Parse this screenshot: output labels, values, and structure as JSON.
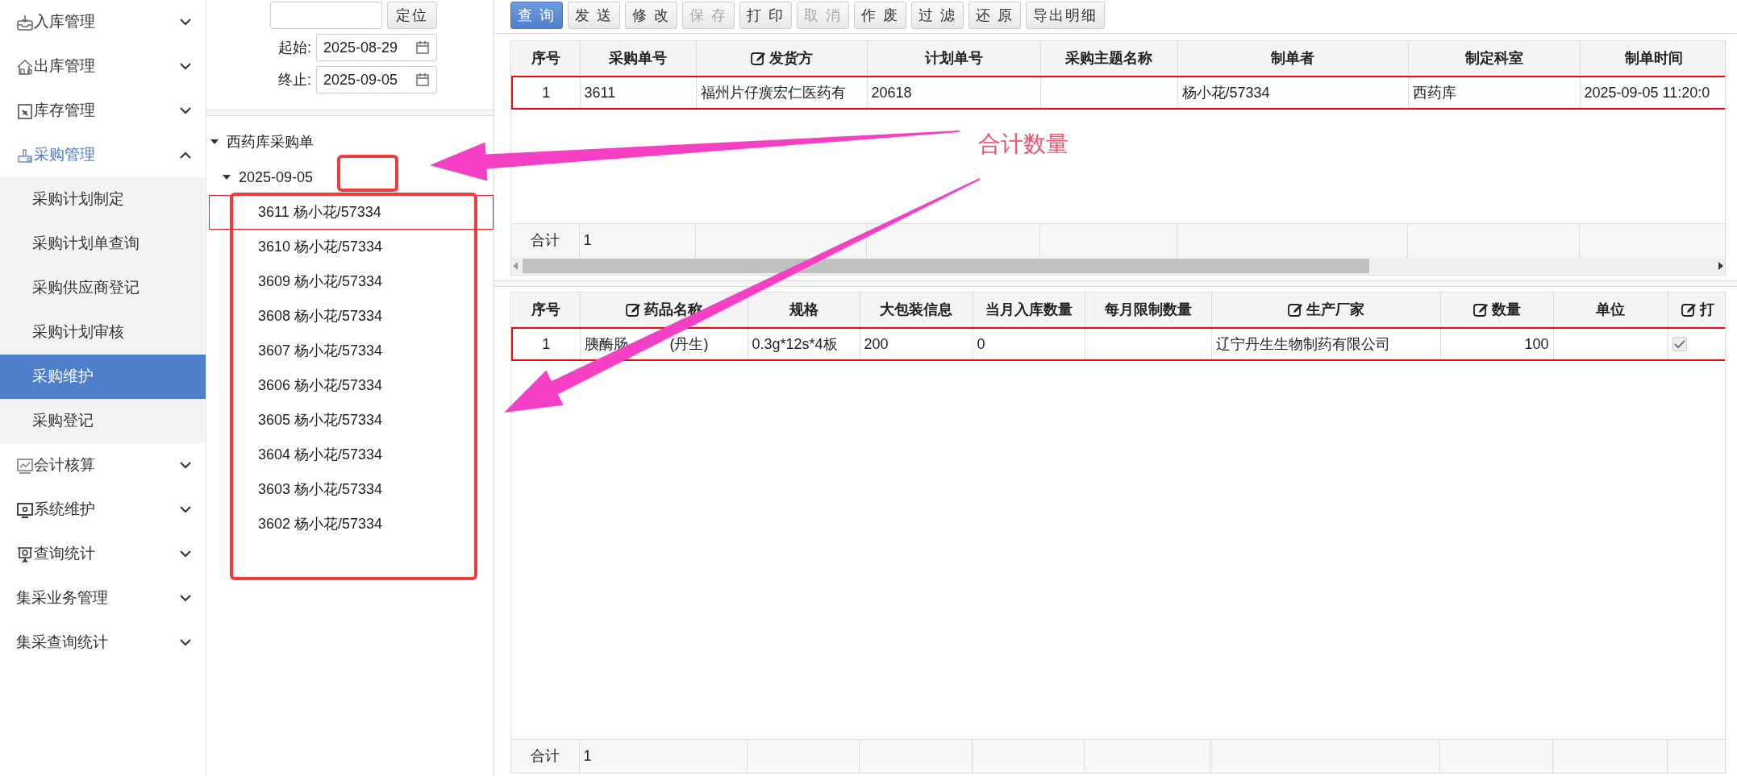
{
  "sidebar": {
    "items": [
      {
        "label": "入库管理",
        "expanded": false
      },
      {
        "label": "出库管理",
        "expanded": false
      },
      {
        "label": "库存管理",
        "expanded": false
      },
      {
        "label": "采购管理",
        "expanded": true,
        "children": [
          {
            "label": "采购计划制定",
            "selected": false
          },
          {
            "label": "采购计划单查询",
            "selected": false
          },
          {
            "label": "采购供应商登记",
            "selected": false
          },
          {
            "label": "采购计划审核",
            "selected": false
          },
          {
            "label": "采购维护",
            "selected": true
          },
          {
            "label": "采购登记",
            "selected": false
          }
        ]
      },
      {
        "label": "会计核算",
        "expanded": false
      },
      {
        "label": "系统维护",
        "expanded": false
      },
      {
        "label": "查询统计",
        "expanded": false
      },
      {
        "label": "集采业务管理",
        "expanded": false
      },
      {
        "label": "集采查询统计",
        "expanded": false
      }
    ]
  },
  "filter": {
    "locate_button": "定位",
    "start": {
      "label": "起始:",
      "value": "2025-08-29"
    },
    "end": {
      "label": "终止:",
      "value": "2025-09-05"
    }
  },
  "tree": {
    "label": "西药库采购单",
    "expanded": true,
    "children": [
      {
        "label": "2025-09-05",
        "expanded": true,
        "children": [
          {
            "label": "3611 杨小花/57334",
            "selected": true
          },
          {
            "label": "3610 杨小花/57334",
            "selected": false
          },
          {
            "label": "3609 杨小花/57334",
            "selected": false
          },
          {
            "label": "3608 杨小花/57334",
            "selected": false
          },
          {
            "label": "3607 杨小花/57334",
            "selected": false
          },
          {
            "label": "3606 杨小花/57334",
            "selected": false
          },
          {
            "label": "3605 杨小花/57334",
            "selected": false
          },
          {
            "label": "3604 杨小花/57334",
            "selected": false
          },
          {
            "label": "3603 杨小花/57334",
            "selected": false
          },
          {
            "label": "3602 杨小花/57334",
            "selected": false
          }
        ]
      }
    ]
  },
  "toolbar": [
    {
      "label": "查 询",
      "primary": true,
      "disabled": false
    },
    {
      "label": "发 送",
      "primary": false,
      "disabled": false
    },
    {
      "label": "修 改",
      "primary": false,
      "disabled": false
    },
    {
      "label": "保 存",
      "primary": false,
      "disabled": true
    },
    {
      "label": "打 印",
      "primary": false,
      "disabled": false
    },
    {
      "label": "取 消",
      "primary": false,
      "disabled": true
    },
    {
      "label": "作 废",
      "primary": false,
      "disabled": false
    },
    {
      "label": "过 滤",
      "primary": false,
      "disabled": false
    },
    {
      "label": "还 原",
      "primary": false,
      "disabled": false
    },
    {
      "label": "导出明细",
      "primary": false,
      "disabled": false
    }
  ],
  "order_table": {
    "columns": [
      {
        "label": "序号",
        "editable": false
      },
      {
        "label": "采购单号",
        "editable": false
      },
      {
        "label": "发货方",
        "editable": true
      },
      {
        "label": "计划单号",
        "editable": false
      },
      {
        "label": "采购主题名称",
        "editable": false
      },
      {
        "label": "制单者",
        "editable": false
      },
      {
        "label": "制定科室",
        "editable": false
      },
      {
        "label": "制单时间",
        "editable": false
      }
    ],
    "rows": [
      {
        "selected": true,
        "cells": [
          "1",
          "3611",
          "福州片仔癀宏仁医药有",
          "20618",
          "",
          "杨小花/57334",
          "西药库",
          "2025-09-05 11:20:0"
        ]
      }
    ],
    "footer": [
      "合计",
      "1"
    ]
  },
  "detail_table": {
    "columns": [
      {
        "label": "序号",
        "editable": false
      },
      {
        "label": "药品名称",
        "editable": true
      },
      {
        "label": "规格",
        "editable": false
      },
      {
        "label": "大包装信息",
        "editable": false
      },
      {
        "label": "当月入库数量",
        "editable": false
      },
      {
        "label": "每月限制数量",
        "editable": false
      },
      {
        "label": "生产厂家",
        "editable": true
      },
      {
        "label": "数量",
        "editable": true
      },
      {
        "label": "单位",
        "editable": false
      },
      {
        "label": "打",
        "editable": true
      }
    ],
    "rows": [
      {
        "selected": true,
        "cells": [
          "1",
          {
            "kind": "split",
            "parts": [
              "胰酶肠",
              "(丹生)"
            ]
          },
          "0.3g*12s*4板",
          "200",
          "0",
          "",
          "辽宁丹生生物制药有限公司",
          "100",
          "",
          {
            "kind": "checkbox",
            "checked": true
          }
        ]
      }
    ],
    "footer": [
      "合计",
      "1"
    ]
  },
  "annotation": {
    "label": "合计数量"
  }
}
